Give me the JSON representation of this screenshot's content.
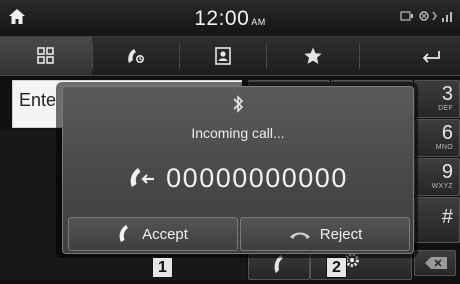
{
  "status_bar": {
    "time": "12:00",
    "ampm": "AM"
  },
  "tabs": [
    {
      "icon": "keypad-icon",
      "active": true
    },
    {
      "icon": "recent-calls-icon",
      "active": false
    },
    {
      "icon": "contacts-icon",
      "active": false
    },
    {
      "icon": "favorites-star-icon",
      "active": false
    }
  ],
  "input": {
    "value": "Ente"
  },
  "keypad": [
    {
      "num": "3",
      "sub": "DEF"
    },
    {
      "num": "6",
      "sub": "MNO"
    },
    {
      "num": "9",
      "sub": "WXYZ"
    },
    {
      "num": "#",
      "sub": ""
    }
  ],
  "popup": {
    "title": "Incoming call...",
    "caller_number": "00000000000",
    "accept_label": "Accept",
    "reject_label": "Reject"
  },
  "callouts": [
    "1",
    "2"
  ],
  "colors": {
    "popup_bg": "#4e4e4e",
    "background": "#101010"
  }
}
